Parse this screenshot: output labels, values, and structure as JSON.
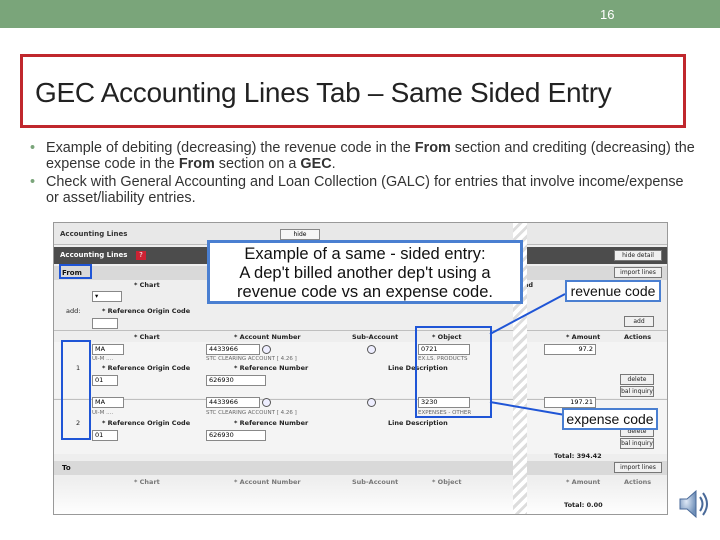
{
  "slide": {
    "number": "16",
    "title": "GEC Accounting Lines Tab – Same Sided Entry",
    "bullets": [
      {
        "pre": "Example of debiting (decreasing) the revenue code in the ",
        "b1": "From",
        "mid": " section and crediting (decreasing) the expense code in the ",
        "b2": "From",
        "mid2": " section on a ",
        "b3": "GEC",
        "post": "."
      },
      {
        "pre": "Check with General Accounting and Loan Collection (GALC) for entries that involve income/expense or asset/liability entries."
      }
    ]
  },
  "screenshot": {
    "tab_title": "Accounting Lines",
    "hide_label": "hide",
    "section_bar": "Accounting Lines",
    "from_label": "From",
    "to_label": "To",
    "buttons": {
      "hide_detail": "hide detail",
      "import_lines": "import lines",
      "add": "add",
      "delete": "delete",
      "balance_inquiry": "bal inquiry"
    },
    "add_label": "add:",
    "headers": {
      "chart": "* Chart",
      "account_number": "* Account Number",
      "sub_account": "Sub-Account",
      "object": "* Object",
      "amount": "* Amount",
      "actions": "Actions",
      "reference_origin_code": "* Reference Origin Code",
      "reference_number": "* Reference Number",
      "line_description": "Line Description",
      "ad": "ad"
    },
    "rows": [
      {
        "index": "1",
        "chart": "MA",
        "account": "4433966",
        "account_desc": "STC CLEARING ACCOUNT [ 4.26 ]",
        "object": "0721",
        "object_desc": "EX.LS. PRODUCTS",
        "amount": "97.2",
        "origin": "01",
        "ref_number": "626930",
        "chart_desc": "UI-M ...."
      },
      {
        "index": "2",
        "chart": "MA",
        "account": "4433966",
        "account_desc": "STC CLEARING ACCOUNT [ 4.26 ]",
        "object": "3230",
        "object_desc": "EXPENSES - OTHER",
        "amount": "197.21",
        "origin": "01",
        "ref_number": "626930",
        "chart_desc": "UI-M ...."
      }
    ],
    "total_from": "Total: 394.42",
    "total_to": "Total: 0.00"
  },
  "callout": {
    "line1": "Example of a same - sided entry:",
    "line2": "A dep't billed another dep't using a",
    "line3": "revenue code vs an expense code."
  },
  "labels": {
    "revenue": "revenue code",
    "expense": "expense code"
  },
  "colors": {
    "topbar": "#7aa57a",
    "title_border": "#c0272d",
    "callout_border": "#4a7fd1"
  },
  "icons": {
    "speaker": "speaker-icon",
    "lookup": "search-icon"
  }
}
